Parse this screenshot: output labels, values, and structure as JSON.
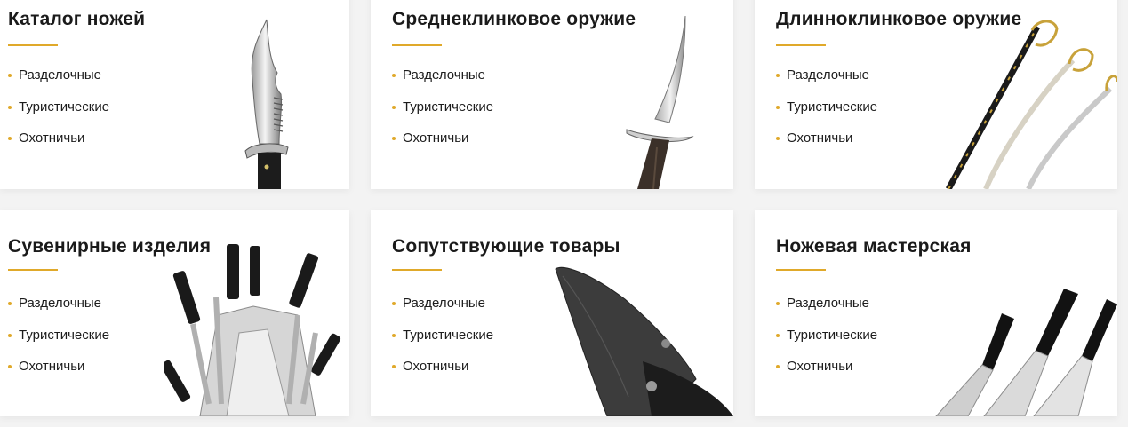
{
  "accent_color": "#e0a92a",
  "cards": [
    {
      "title": "Каталог ножей",
      "image_icon": "hunting-knife-icon",
      "links": [
        "Разделочные",
        "Туристические",
        "Охотничьи"
      ]
    },
    {
      "title": "Среднеклинковое оружие",
      "image_icon": "dagger-icon",
      "links": [
        "Разделочные",
        "Туристические",
        "Охотничьи"
      ]
    },
    {
      "title": "Длинноклинковое оружие",
      "image_icon": "sabers-icon",
      "links": [
        "Разделочные",
        "Туристические",
        "Охотничьи"
      ]
    },
    {
      "title": "Сувенирные изделия",
      "image_icon": "knife-set-icon",
      "links": [
        "Разделочные",
        "Туристические",
        "Охотничьи"
      ]
    },
    {
      "title": "Сопутствующие товары",
      "image_icon": "knife-sheath-icon",
      "links": [
        "Разделочные",
        "Туристические",
        "Охотничьи"
      ]
    },
    {
      "title": "Ножевая мастерская",
      "image_icon": "kitchen-knives-icon",
      "links": [
        "Разделочные",
        "Туристические",
        "Охотничьи"
      ]
    }
  ]
}
